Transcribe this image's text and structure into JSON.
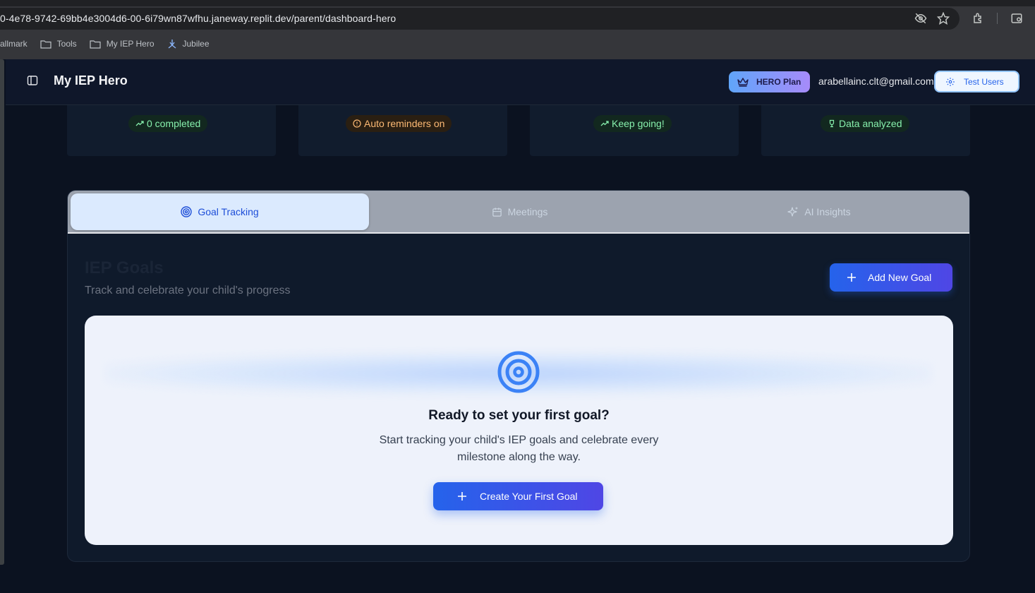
{
  "browser": {
    "url": "0-4e78-9742-69bb4e3004d6-00-6i79wn87wfhu.janeway.replit.dev/parent/dashboard-hero",
    "bookmarks": [
      {
        "label": "allmark",
        "icon": "none"
      },
      {
        "label": "Tools",
        "icon": "folder-icon"
      },
      {
        "label": "My IEP Hero",
        "icon": "folder-icon"
      },
      {
        "label": "Jubilee",
        "icon": "jubilee-logo-icon"
      }
    ]
  },
  "header": {
    "app_title": "My IEP Hero",
    "plan_label": "HERO Plan",
    "user_email": "arabellainc.clt@gmail.com",
    "test_users_label": "Test Users"
  },
  "stats": [
    {
      "label": "0 completed",
      "icon": "trending-up-icon",
      "tone": "green"
    },
    {
      "label": "Auto reminders on",
      "icon": "alert-circle-icon",
      "tone": "orange"
    },
    {
      "label": "Keep going!",
      "icon": "trending-up-icon",
      "tone": "green"
    },
    {
      "label": "Data analyzed",
      "icon": "trophy-icon",
      "tone": "green"
    }
  ],
  "tabs": [
    {
      "label": "Goal Tracking",
      "icon": "target-icon",
      "active": true
    },
    {
      "label": "Meetings",
      "icon": "calendar-icon",
      "active": false
    },
    {
      "label": "AI Insights",
      "icon": "sparkles-icon",
      "active": false
    }
  ],
  "goals": {
    "title": "IEP Goals",
    "subtitle": "Track and celebrate your child's progress",
    "add_button_label": "Add New Goal"
  },
  "empty_state": {
    "title": "Ready to set your first goal?",
    "description": "Start tracking your child's IEP goals and celebrate every milestone along the way.",
    "button_label": "Create Your First Goal"
  },
  "colors": {
    "accent": "#2563eb",
    "accent_end": "#4f46e5",
    "app_background": "#0b1220",
    "success_text": "#86efac",
    "warning_text": "#fdba74"
  }
}
